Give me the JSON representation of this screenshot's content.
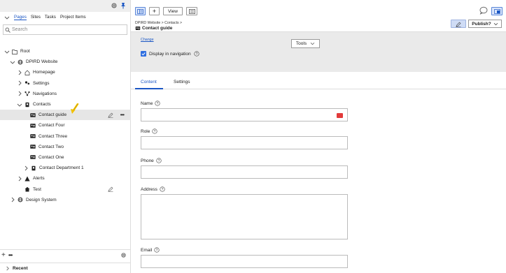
{
  "sidebar": {
    "tabs": [
      "Pages",
      "Sites",
      "Tasks",
      "Project Items"
    ],
    "search_placeholder": "Search",
    "tree": [
      {
        "label": "Root"
      },
      {
        "label": "DPIRD Website"
      },
      {
        "label": "Homepage"
      },
      {
        "label": "Settings"
      },
      {
        "label": "Navigations"
      },
      {
        "label": "Contacts"
      },
      {
        "label": "Contact guide"
      },
      {
        "label": "Contact Four"
      },
      {
        "label": "Contact Three"
      },
      {
        "label": "Contact Two"
      },
      {
        "label": "Contact One"
      },
      {
        "label": "Contact Department 1"
      },
      {
        "label": "Alerts"
      },
      {
        "label": "Test"
      },
      {
        "label": "Design System"
      }
    ],
    "more_label": "•••",
    "add_label": "+",
    "recent_label": "Recent"
  },
  "toolbar": {
    "add_label": "+",
    "view_label": "View"
  },
  "page": {
    "breadcrumb": "DPIRD Website  >  Contacts  >",
    "title": "Contact guide",
    "publish_label": "Publish?",
    "change_label": "Change",
    "tools_label": "Tools",
    "display_nav_label": "Display in navigation"
  },
  "content_tabs": [
    "Content",
    "Settings"
  ],
  "fields": [
    {
      "label": "Name",
      "value": ""
    },
    {
      "label": "Role",
      "value": ""
    },
    {
      "label": "Phone",
      "value": ""
    },
    {
      "label": "Address",
      "value": ""
    },
    {
      "label": "Email",
      "value": ""
    }
  ],
  "colors": {
    "accent": "#1a56c4",
    "checkbox": "#2f6fe0",
    "panel": "#eaeaea",
    "arrow": "#f2c200"
  }
}
